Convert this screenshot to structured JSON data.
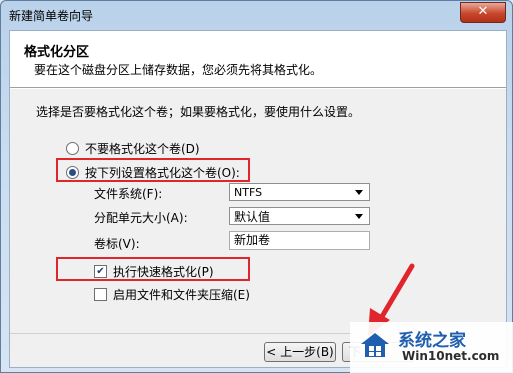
{
  "window": {
    "title": "新建简单卷向导",
    "close_label": "✕"
  },
  "header": {
    "title": "格式化分区",
    "subtitle": "要在这个磁盘分区上储存数据，您必须先将其格式化。"
  },
  "instruction": "选择是否要格式化这个卷；如果要格式化，要使用什么设置。",
  "options": {
    "no_format": {
      "label": "不要格式化这个卷(D)",
      "selected": false
    },
    "format_with": {
      "label": "按下列设置格式化这个卷(O):",
      "selected": true
    }
  },
  "settings": {
    "filesystem": {
      "label": "文件系统(F):",
      "value": "NTFS"
    },
    "allocation": {
      "label": "分配单元大小(A):",
      "value": "默认值"
    },
    "volume_label": {
      "label": "卷标(V):",
      "value": "新加卷"
    }
  },
  "checkboxes": {
    "quick_format": {
      "label": "执行快速格式化(P)",
      "checked": true
    },
    "compression": {
      "label": "启用文件和文件夹压缩(E)",
      "checked": false
    }
  },
  "buttons": {
    "back": "< 上一步(B)",
    "next": "下"
  },
  "annotation_colors": {
    "highlight": "#e0262c"
  },
  "watermark": {
    "title": "系统之家",
    "url": "Win10net.com"
  }
}
